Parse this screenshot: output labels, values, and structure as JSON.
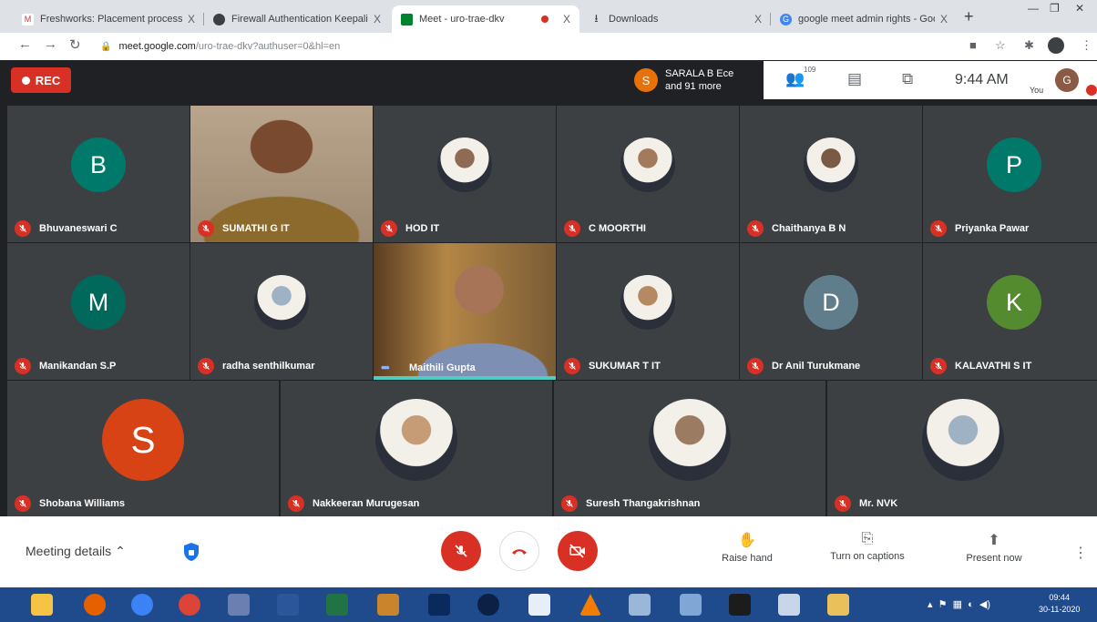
{
  "browser": {
    "tabs": [
      {
        "title": "Freshworks: Placement process",
        "close": "X",
        "favicon": "gmail-icon"
      },
      {
        "title": "Firewall Authentication Keepalive",
        "close": "X",
        "favicon": "globe-icon"
      },
      {
        "title": "Meet - uro-trae-dkv",
        "close": "X",
        "favicon": "meet-icon",
        "active": true
      },
      {
        "title": "Downloads",
        "close": "X",
        "favicon": "download-icon"
      },
      {
        "title": "google meet admin rights - Goo",
        "close": "X",
        "favicon": "google-icon"
      }
    ],
    "new_tab": "+",
    "url_host": "meet.google.com",
    "url_path": "/uro-trae-dkv?authuser=0&hl=en"
  },
  "meet": {
    "rec_label": "REC",
    "joined_initial": "S",
    "joined_line1": "SARALA B Ece",
    "joined_line2": "and 91 more",
    "people_count": "109",
    "clock": "9:44 AM",
    "you_label": "You",
    "me_initial": "G"
  },
  "participants": [
    {
      "name": "Bhuvaneswari C",
      "initial": "B",
      "color": "#00796b",
      "kind": "letter",
      "muted": true
    },
    {
      "name": "SUMATHI G IT",
      "kind": "video",
      "muted": true
    },
    {
      "name": "HOD IT",
      "kind": "photo",
      "muted": true
    },
    {
      "name": "C MOORTHI",
      "kind": "photo",
      "muted": true
    },
    {
      "name": "Chaithanya B N",
      "kind": "photo",
      "muted": true
    },
    {
      "name": "Priyanka Pawar",
      "initial": "P",
      "color": "#00796b",
      "kind": "letter",
      "muted": true
    },
    {
      "name": "Manikandan S.P",
      "initial": "M",
      "color": "#00695c",
      "kind": "letter",
      "muted": true
    },
    {
      "name": "radha senthilkumar",
      "kind": "photo",
      "muted": true
    },
    {
      "name": "Maithili Gupta",
      "kind": "video",
      "muted": false
    },
    {
      "name": "SUKUMAR T IT",
      "kind": "photo",
      "muted": true
    },
    {
      "name": "Dr Anil Turukmane",
      "initial": "D",
      "color": "#607d8b",
      "kind": "letter",
      "muted": true
    },
    {
      "name": "KALAVATHI S IT",
      "initial": "K",
      "color": "#558b2f",
      "kind": "letter",
      "muted": true
    },
    {
      "name": "Shobana Williams",
      "initial": "S",
      "color": "#d84315",
      "kind": "letter",
      "muted": true
    },
    {
      "name": "Nakkeeran Murugesan",
      "kind": "photo",
      "muted": true
    },
    {
      "name": "Suresh Thangakrishnan",
      "kind": "photo",
      "muted": true
    },
    {
      "name": "Mr. NVK",
      "kind": "photo",
      "muted": true
    }
  ],
  "controls": {
    "meeting_details": "Meeting details",
    "raise_hand": "Raise hand",
    "captions": "Turn on captions",
    "present": "Present now"
  },
  "taskbar": {
    "time": "09:44",
    "date": "30-11-2020"
  },
  "colors": {
    "rec": "#d93025",
    "muted_badge": "#d93025",
    "taskbar": "#1f4a8c",
    "speaking": "#8ab4f8"
  }
}
